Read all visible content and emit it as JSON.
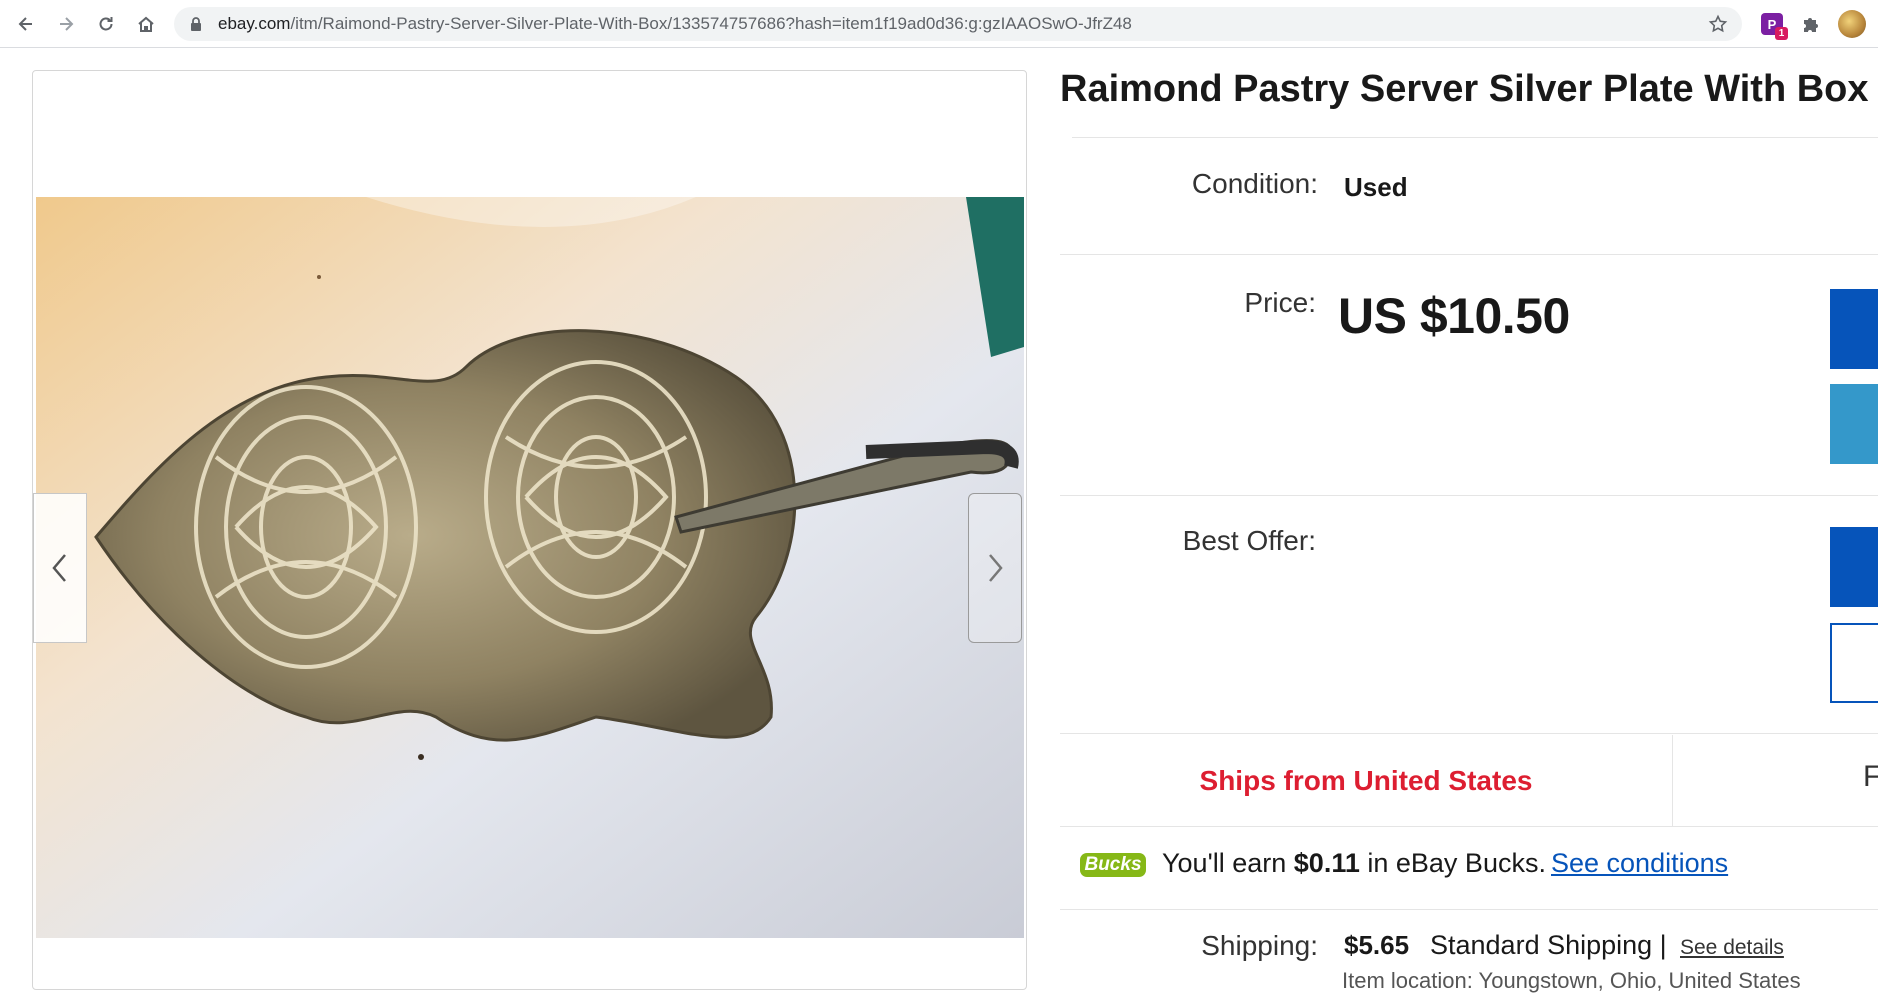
{
  "browser": {
    "url_host": "ebay.com",
    "url_path": "/itm/Raimond-Pastry-Server-Silver-Plate-With-Box/133574757686?hash=item1f19ad0d36:g:gzIAAOSwO-JfrZ48",
    "extension_badge": "1",
    "icons": [
      "back-icon",
      "forward-icon",
      "reload-icon",
      "home-icon",
      "lock-icon",
      "star-icon",
      "puzzle-icon"
    ]
  },
  "listing": {
    "title": "Raimond Pastry Server Silver Plate With Box",
    "condition_label": "Condition:",
    "condition_value": "Used",
    "price_label": "Price:",
    "price_value": "US $10.50",
    "best_offer_label": "Best Offer:",
    "ships_from": "Ships from United States",
    "right_cell_peek": "F",
    "bucks_logo": "Bucks",
    "bucks_prefix": "You'll earn",
    "bucks_amount": "$0.11",
    "bucks_suffix": "in eBay Bucks.",
    "bucks_link": "See conditions",
    "shipping_label": "Shipping:",
    "shipping_value": "$5.65",
    "shipping_type": "Standard Shipping |",
    "shipping_link": "See details",
    "location_peek": "Item location: Youngstown, Ohio, United States"
  },
  "colors": {
    "ebay_blue": "#0654ba",
    "button_primary": "#0654ba",
    "button_secondary": "#3498ca",
    "ships_red": "#dd1e31",
    "bucks_green": "#86b817"
  }
}
